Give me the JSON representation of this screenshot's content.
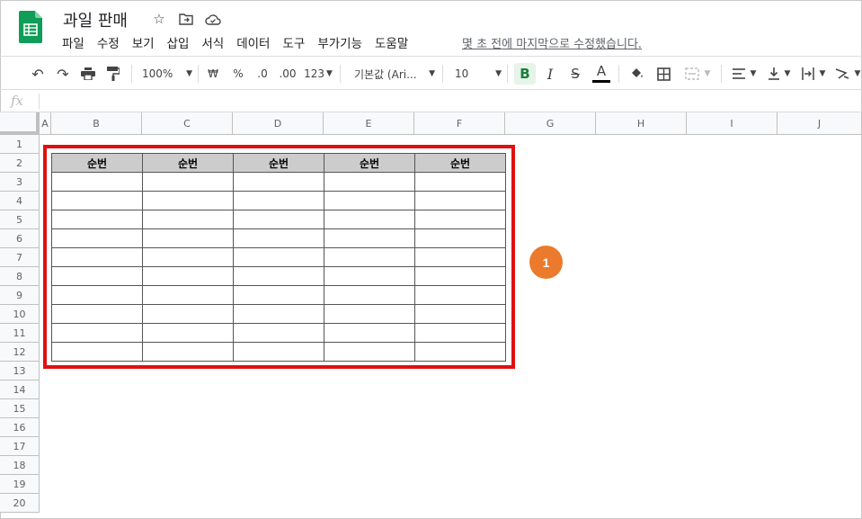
{
  "doc": {
    "title": "과일 판매",
    "last_edit": "몇 초 전에 마지막으로 수정했습니다."
  },
  "menu": [
    "파일",
    "수정",
    "보기",
    "삽입",
    "서식",
    "데이터",
    "도구",
    "부가기능",
    "도움말"
  ],
  "toolbar": {
    "zoom": "100%",
    "currency": "₩",
    "percent": "%",
    "dec_decrease": ".0",
    "dec_increase": ".00",
    "format_more": "123",
    "font": "기본값 (Ari...",
    "font_size": "10",
    "bold": "B",
    "italic": "I",
    "strike": "S",
    "text_color": "A"
  },
  "formula_bar": {
    "fx": "fx"
  },
  "columns": [
    "A",
    "B",
    "C",
    "D",
    "E",
    "F",
    "G",
    "H",
    "I",
    "J"
  ],
  "rows": [
    "1",
    "2",
    "3",
    "4",
    "5",
    "6",
    "7",
    "8",
    "9",
    "10",
    "11",
    "12",
    "13",
    "14",
    "15",
    "16",
    "17",
    "18",
    "19",
    "20"
  ],
  "table": {
    "headers": [
      "순번",
      "순번",
      "순번",
      "순번",
      "순번"
    ],
    "empty_rows": 10
  },
  "annotation": {
    "badge": "1"
  },
  "colors": {
    "highlight": "#e01010",
    "badge": "#ec7a2c",
    "header_fill": "#cccccc",
    "logo": "#0f9d58"
  },
  "icons": [
    "undo-icon",
    "redo-icon",
    "print-icon",
    "paint-format-icon",
    "fill-color-icon",
    "borders-icon",
    "merge-icon",
    "align-icon",
    "valign-icon",
    "wrap-icon",
    "rotate-icon",
    "star-icon",
    "move-icon",
    "cloud-icon"
  ]
}
